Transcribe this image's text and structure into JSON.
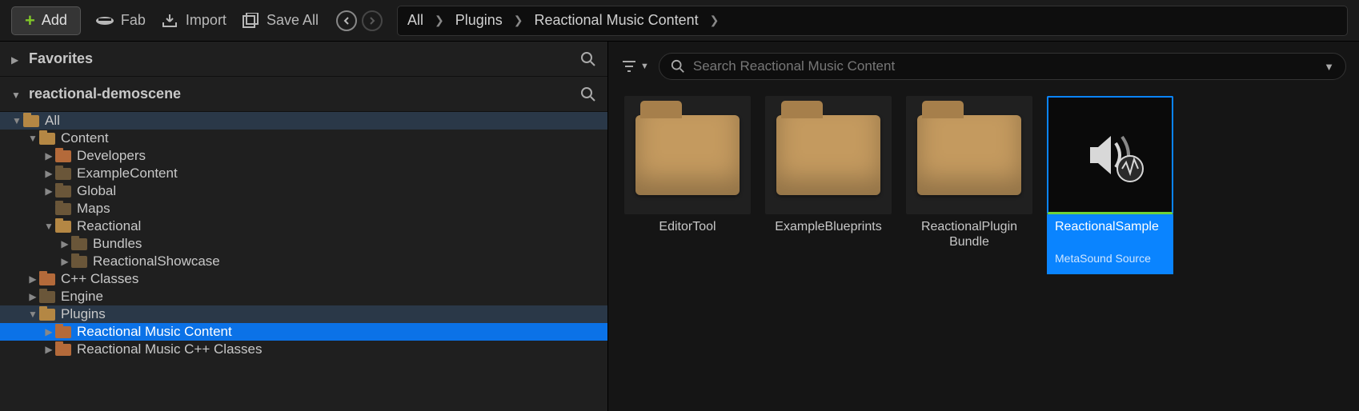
{
  "toolbar": {
    "add": "Add",
    "fab": "Fab",
    "import": "Import",
    "save_all": "Save All"
  },
  "breadcrumb": [
    "All",
    "Plugins",
    "Reactional Music Content"
  ],
  "favorites_label": "Favorites",
  "project_label": "reactional-demoscene",
  "tree": {
    "root": "All",
    "content": "Content",
    "developers": "Developers",
    "example_content": "ExampleContent",
    "global": "Global",
    "maps": "Maps",
    "reactional": "Reactional",
    "bundles": "Bundles",
    "reactional_showcase": "ReactionalShowcase",
    "cpp_classes": "C++ Classes",
    "engine": "Engine",
    "plugins": "Plugins",
    "reactional_music_content": "Reactional Music Content",
    "reactional_music_cpp": "Reactional Music C++ Classes"
  },
  "search": {
    "placeholder": "Search Reactional Music Content"
  },
  "assets": [
    {
      "name": "EditorTool",
      "type": "folder"
    },
    {
      "name": "ExampleBlueprints",
      "type": "folder"
    },
    {
      "name": "ReactionalPlugin Bundle",
      "type": "folder"
    },
    {
      "name": "ReactionalSample",
      "type": "MetaSound Source",
      "selected": true
    }
  ]
}
